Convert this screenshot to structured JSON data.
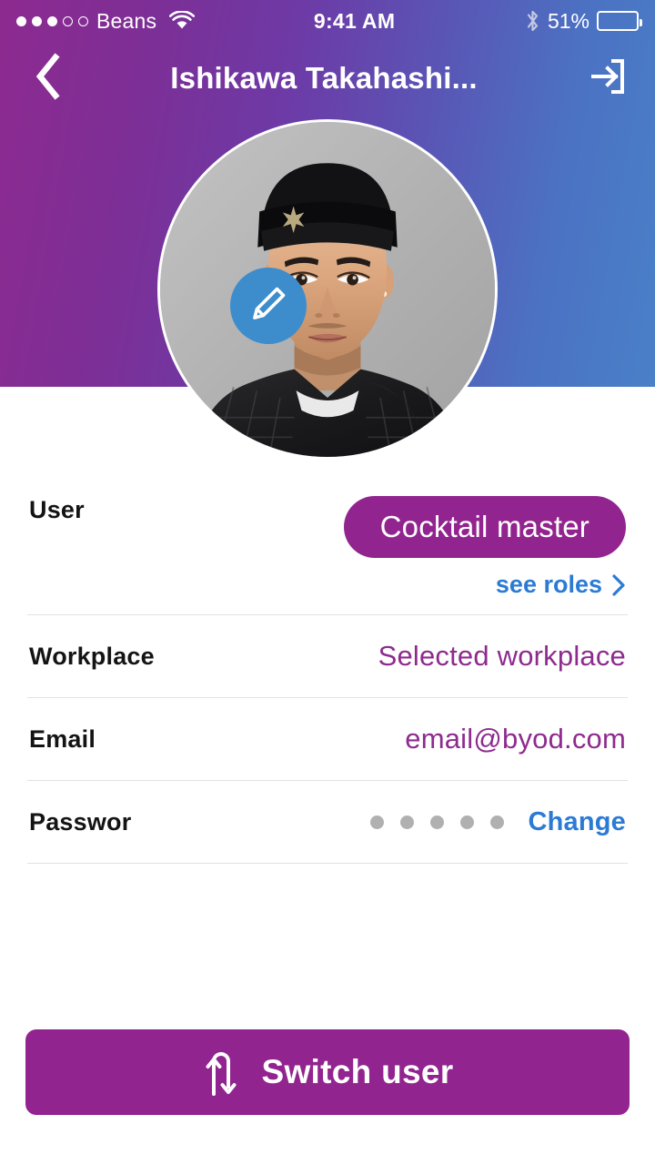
{
  "status_bar": {
    "signal_dots_total": 5,
    "signal_dots_filled": 3,
    "carrier": "Beans",
    "wifi_icon": "wifi-icon",
    "time": "9:41 AM",
    "bluetooth_icon": "bluetooth-icon",
    "battery_percent": "51%",
    "battery_level": 51
  },
  "navbar": {
    "back_icon": "chevron-left-icon",
    "title": "Ishikawa Takahashi...",
    "logout_icon": "logout-icon"
  },
  "profile": {
    "avatar_alt": "user-profile-photo",
    "edit_icon": "pencil-icon"
  },
  "fields": {
    "user": {
      "label": "User",
      "role": "Cocktail master",
      "see_roles": "see roles",
      "chevron_icon": "chevron-right-icon"
    },
    "workplace": {
      "label": "Workplace",
      "value": "Selected workplace"
    },
    "email": {
      "label": "Email",
      "value": "email@byod.com"
    },
    "password": {
      "label": "Passwor",
      "masked_dots": 5,
      "change_label": "Change"
    }
  },
  "switch_user": {
    "label": "Switch user",
    "icon": "swap-arrows-icon"
  },
  "colors": {
    "brand_purple": "#92248f",
    "link_blue": "#2b7bd4",
    "fab_blue": "#3d8dcc",
    "value_purple": "#8e2b8e",
    "gradient_start": "#8d2a90",
    "gradient_end": "#4a80c8"
  }
}
